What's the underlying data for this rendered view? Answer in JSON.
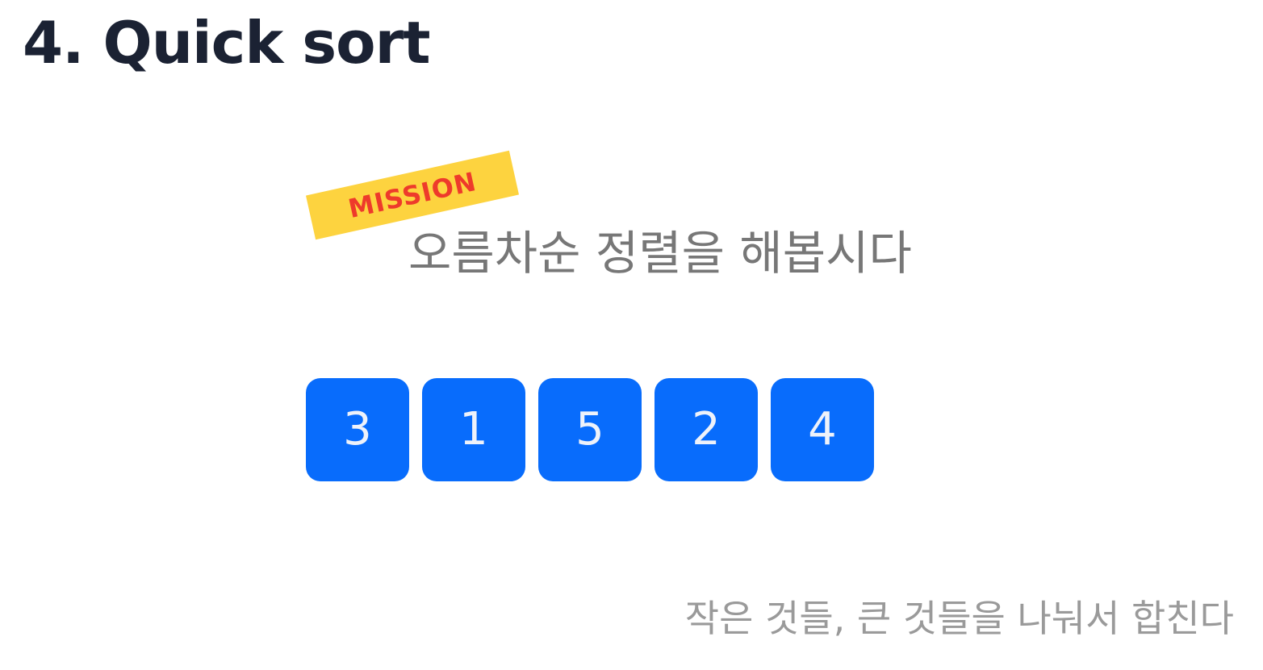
{
  "slide": {
    "title": "4. Quick sort",
    "mission_badge": "MISSION",
    "mission_statement": "오름차순 정렬을 해봅시다",
    "numbers": [
      "3",
      "1",
      "5",
      "2",
      "4"
    ],
    "caption": "작은 것들, 큰 것들을 나눠서 합친다"
  },
  "colors": {
    "title": "#1b2233",
    "badge_background": "#fdd33f",
    "badge_text": "#ee3a2b",
    "card_background": "#086cfc",
    "card_text": "#eef2fa",
    "statement_text": "#777777",
    "caption_text": "#9a9a9a"
  }
}
